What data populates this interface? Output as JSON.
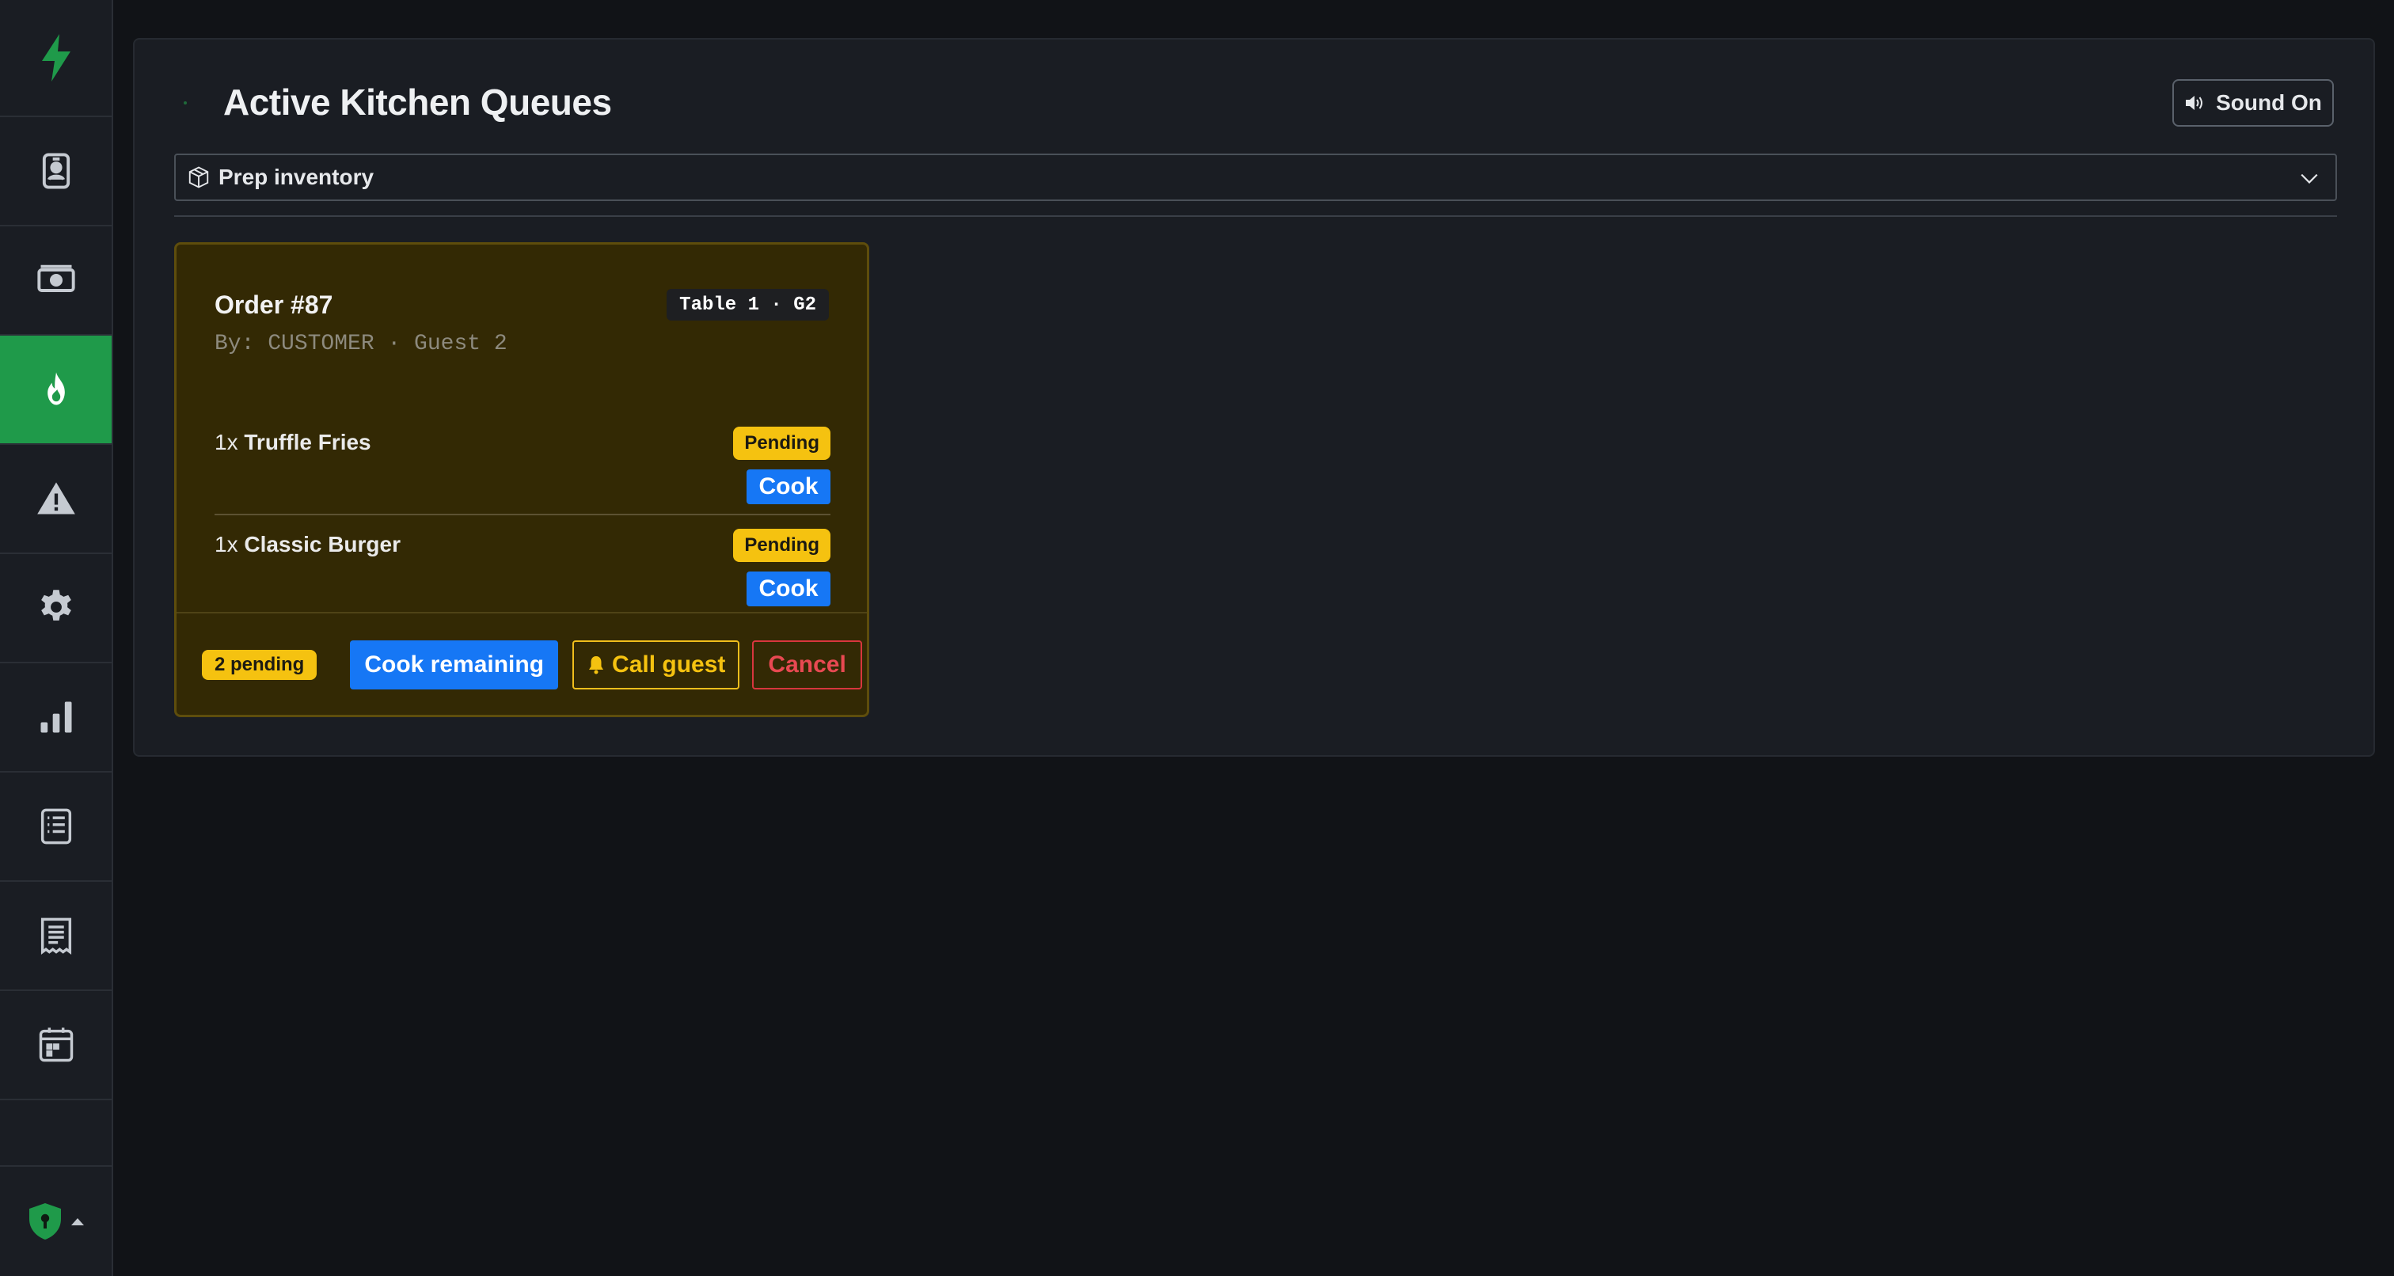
{
  "sidebar": {
    "logo_icon": "lightning-bolt-icon",
    "items": [
      {
        "icon": "id-badge-icon",
        "active": false
      },
      {
        "icon": "cash-icon",
        "active": false
      },
      {
        "icon": "fire-icon",
        "active": true
      },
      {
        "icon": "warning-icon",
        "active": false
      },
      {
        "icon": "gear-icon",
        "active": false
      },
      {
        "icon": "bar-chart-icon",
        "active": false
      },
      {
        "icon": "checklist-icon",
        "active": false
      },
      {
        "icon": "receipt-icon",
        "active": false
      },
      {
        "icon": "calendar-icon",
        "active": false
      }
    ],
    "bottom_icon": "shield-lock-icon"
  },
  "header": {
    "title": "Active Kitchen Queues",
    "sound_label": "Sound On"
  },
  "prep": {
    "label": "Prep inventory"
  },
  "order": {
    "title": "Order #87",
    "table_badge": "Table 1 · G2",
    "by_line": "By: CUSTOMER · Guest 2",
    "items": [
      {
        "qty": "1x",
        "name": "Truffle Fries",
        "status": "Pending",
        "action": "Cook"
      },
      {
        "qty": "1x",
        "name": "Classic Burger",
        "status": "Pending",
        "action": "Cook"
      }
    ],
    "footer": {
      "pending_count": "2 pending",
      "cook_remaining": "Cook remaining",
      "call_guest": "Call guest",
      "cancel": "Cancel"
    }
  },
  "colors": {
    "accent_green": "#1f9a4a",
    "primary_blue": "#1677f5",
    "warning_yellow": "#f5c210",
    "danger_red": "#d8363e"
  }
}
